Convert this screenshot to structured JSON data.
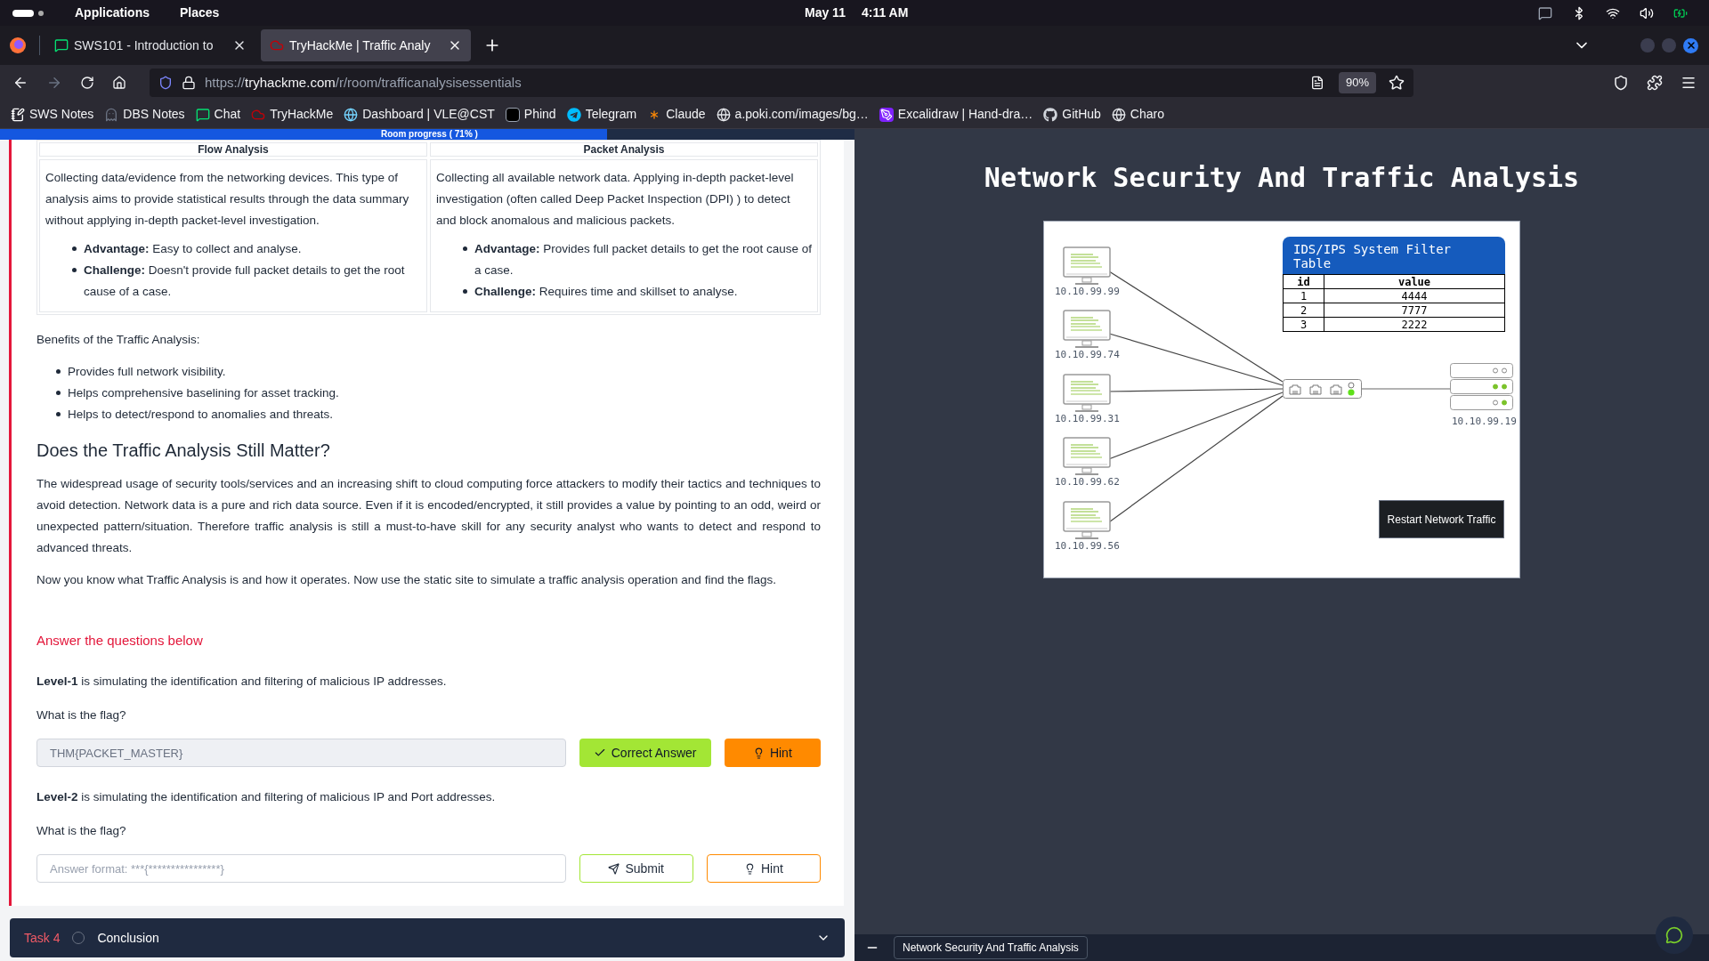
{
  "system_bar": {
    "menus": [
      "Applications",
      "Places"
    ],
    "date": "May 11",
    "time": "4:11 AM"
  },
  "tabs": [
    {
      "title": "SWS101 - Introduction to",
      "selected": false
    },
    {
      "title": "TryHackMe | Traffic Analy",
      "selected": true
    }
  ],
  "nav": {
    "forward_disabled": true,
    "url_scheme": "https://",
    "url_host": "tryhackme.com",
    "url_path": "/r/room/trafficanalysisessentials",
    "zoom": "90%"
  },
  "bookmarks": [
    "SWS Notes",
    "DBS Notes",
    "Chat",
    "TryHackMe",
    "Dashboard | VLE@CST",
    "Phind",
    "Telegram",
    "Claude",
    "a.poki.com/images/bg…",
    "Excalidraw | Hand-dra…",
    "GitHub",
    "Charo"
  ],
  "progress": {
    "label": "Room progress ( 71% )",
    "level": 0.71
  },
  "comparison": [
    {
      "heading": "Flow Analysis",
      "description": "Collecting data/evidence from the networking devices. This type of analysis aims to provide statistical results through the data summary without applying in-depth packet-level investigation.",
      "points": [
        "**Advantage:** Easy to collect and analyse.",
        "**Challenge:** Doesn't provide full packet details to get the root cause of a case."
      ]
    },
    {
      "heading": "Packet Analysis",
      "description": "Collecting all available network data. Applying in-depth packet-level investigation (often called Deep Packet Inspection (DPI) ) to detect and block anomalous and malicious packets.",
      "points": [
        "**Advantage:** Provides full packet details to get the root cause of a case.",
        "**Challenge:** Requires time and skillset to analyse."
      ]
    }
  ],
  "benefits": {
    "intro": "Benefits of the Traffic Analysis:",
    "items": [
      "Provides full network visibility.",
      "Helps comprehensive baselining for asset tracking.",
      "Helps to detect/respond to anomalies and threats."
    ]
  },
  "section": {
    "heading": "Does the Traffic Analysis Still Matter?",
    "paragraphs": [
      "The widespread usage of security tools/services and an increasing shift to cloud computing force attackers to modify their tactics and techniques to avoid detection. Network data is a pure and rich data source. Even if it is encoded/encrypted, it still provides a value by pointing to an odd, weird or unexpected pattern/situation. Therefore traffic analysis is still a must-to-have skill for any security analyst who wants to detect and respond to advanced threats.",
      "Now you know what Traffic Analysis is and how it operates. Now use the static site to simulate a traffic analysis operation and find the flags."
    ]
  },
  "questions_heading": "Answer the questions below",
  "questions": [
    {
      "intro": "**Level-1** is simulating the identification and filtering of malicious IP addresses.",
      "prompt": "What is the flag?",
      "value": "THM{PACKET_MASTER}",
      "answered": true,
      "submit_label": "Correct Answer",
      "hint_label": "Hint"
    },
    {
      "intro": "**Level-2** is simulating the identification and filtering of malicious IP and Port addresses.",
      "prompt": "What is the flag?",
      "placeholder": "Answer format: ***{****************}",
      "answered": false,
      "submit_label": "Submit",
      "hint_label": "Hint"
    }
  ],
  "next_task": {
    "label": "Task 4",
    "title": "Conclusion",
    "completed": false
  },
  "site": {
    "title": "Network Security And Traffic Analysis",
    "clients": [
      "10.10.99.99",
      "10.10.99.74",
      "10.10.99.31",
      "10.10.99.62",
      "10.10.99.56"
    ],
    "filter_table": {
      "title": "IDS/IPS System Filter Table",
      "columns": [
        "id",
        "value"
      ],
      "rows": [
        [
          "1",
          "4444"
        ],
        [
          "2",
          "7777"
        ],
        [
          "3",
          "2222"
        ]
      ]
    },
    "server_ip": "10.10.99.19",
    "restart_button": "Restart Network Traffic"
  },
  "footer_tab": "Network Security And Traffic Analysis"
}
